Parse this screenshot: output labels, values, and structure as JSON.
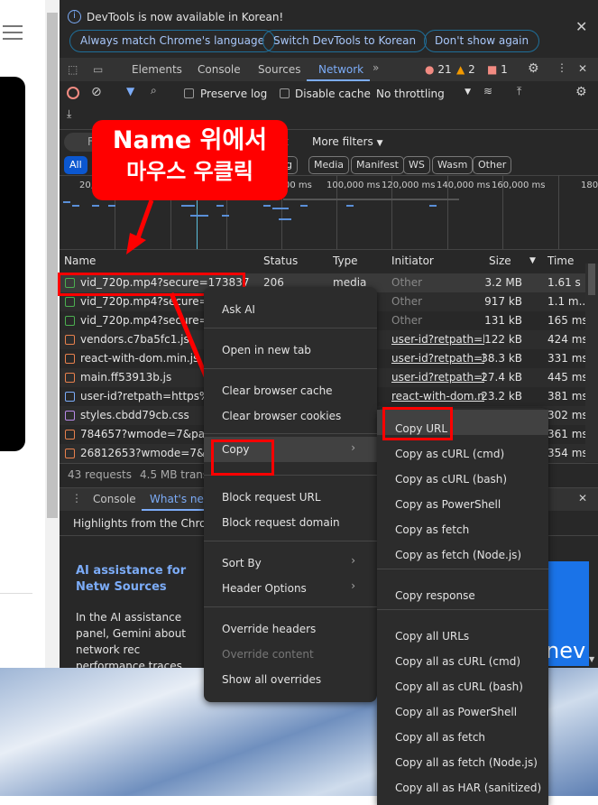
{
  "infobar": {
    "message": "DevTools is now available in Korean!",
    "buttons": [
      "Always match Chrome's language",
      "Switch DevTools to Korean",
      "Don't show again"
    ]
  },
  "tabs": [
    "Elements",
    "Console",
    "Sources",
    "Network"
  ],
  "active_tab": "Network",
  "counts": {
    "errors": "21",
    "warnings": "2",
    "issues": "1"
  },
  "toolbar": {
    "preserve_log": "Preserve log",
    "disable_cache": "Disable cache",
    "throttling": "No throttling"
  },
  "filter": {
    "placeholder": "F",
    "more_filters": "More filters",
    "t": "t"
  },
  "chips": [
    "All",
    "Img",
    "Media",
    "Manifest",
    "WS",
    "Wasm",
    "Other"
  ],
  "timeline": [
    "20,0",
    "00 ms",
    "100,000 ms",
    "120,000 ms",
    "140,000 ms",
    "160,000 ms",
    "180"
  ],
  "table": {
    "headers": [
      "Name",
      "Status",
      "Type",
      "Initiator",
      "Size",
      "Time"
    ],
    "rows": [
      {
        "name": "vid_720p.mp4?secure=173837",
        "status": "206",
        "type": "media",
        "initiator": "Other",
        "size": "3.2 MB",
        "time": "1.61 s",
        "icon": "media"
      },
      {
        "name": "vid_720p.mp4?secure=17",
        "initiator": "Other",
        "size": "917 kB",
        "time": "1.1 m...",
        "icon": "media"
      },
      {
        "name": "vid_720p.mp4?secure=17",
        "initiator": "Other",
        "size": "131 kB",
        "time": "165 ms",
        "icon": "media"
      },
      {
        "name": "vendors.c7ba5fc1.js",
        "initiator": "user-id?retpath=htt",
        "size": "122 kB",
        "time": "424 ms",
        "icon": "script"
      },
      {
        "name": "react-with-dom.min.js",
        "initiator": "user-id?retpath=htt",
        "size": "38.3 kB",
        "time": "331 ms",
        "icon": "script"
      },
      {
        "name": "main.ff53913b.js",
        "initiator": "user-id?retpath=htt",
        "size": "27.4 kB",
        "time": "445 ms",
        "icon": "script"
      },
      {
        "name": "user-id?retpath=https%3A",
        "initiator": "react-with-dom.min",
        "size": "23.2 kB",
        "time": "381 ms",
        "icon": "document"
      },
      {
        "name": "styles.cbdd79cb.css",
        "time": "302 ms",
        "icon": "stylesheet"
      },
      {
        "name": "784657?wmode=7&page",
        "time": "361 ms",
        "icon": "fetch"
      },
      {
        "name": "26812653?wmode=7&pa",
        "time": "354 ms",
        "icon": "fetch"
      }
    ]
  },
  "status": {
    "requests": "43 requests",
    "transferred": "4.5 MB trans"
  },
  "drawer": {
    "tabs": [
      "Console",
      "What's new"
    ],
    "highlights": "Highlights from the Chrom",
    "heading": "AI assistance for Netw Sources",
    "body": "In the AI assistance panel, Gemini about network rec performance traces.",
    "banner": "nev"
  },
  "annotation": {
    "line1": "Name 위에서",
    "line2": "마우스 우클릭"
  },
  "context_menu": [
    "Ask AI",
    "Open in new tab",
    "Clear browser cache",
    "Clear browser cookies",
    "Copy",
    "Block request URL",
    "Block request domain",
    "Sort By",
    "Header Options",
    "Override headers",
    "Override content",
    "Show all overrides"
  ],
  "copy_menu": [
    "Copy URL",
    "Copy as cURL (cmd)",
    "Copy as cURL (bash)",
    "Copy as PowerShell",
    "Copy as fetch",
    "Copy as fetch (Node.js)",
    "Copy response",
    "Copy all URLs",
    "Copy all as cURL (cmd)",
    "Copy all as cURL (bash)",
    "Copy all as PowerShell",
    "Copy all as fetch",
    "Copy all as fetch (Node.js)",
    "Copy all as HAR (sanitized)"
  ],
  "colors": {
    "accent": "#7cacf8",
    "annotation": "#ff0000"
  }
}
